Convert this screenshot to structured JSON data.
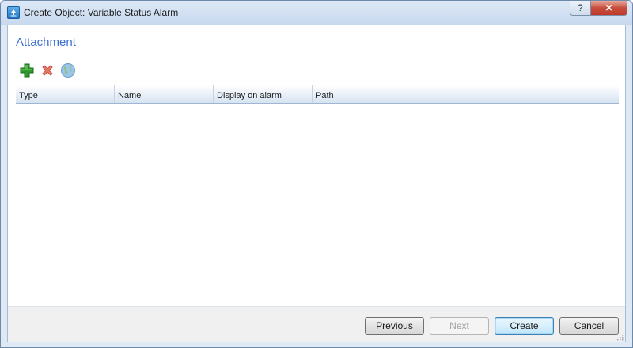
{
  "window": {
    "title": "Create Object: Variable Status Alarm",
    "help_label": "?",
    "close_label": "✕"
  },
  "section": {
    "title": "Attachment"
  },
  "toolbar": {
    "add_icon": "add-icon",
    "delete_icon": "delete-icon",
    "web_icon": "globe-icon"
  },
  "grid": {
    "columns": [
      "Type",
      "Name",
      "Display on alarm",
      "Path"
    ],
    "rows": []
  },
  "buttons": {
    "previous": "Previous",
    "next": "Next",
    "create": "Create",
    "cancel": "Cancel"
  },
  "colors": {
    "accent": "#3c6fd0",
    "add": "#2e9a2e",
    "delete": "#e06a5a"
  }
}
